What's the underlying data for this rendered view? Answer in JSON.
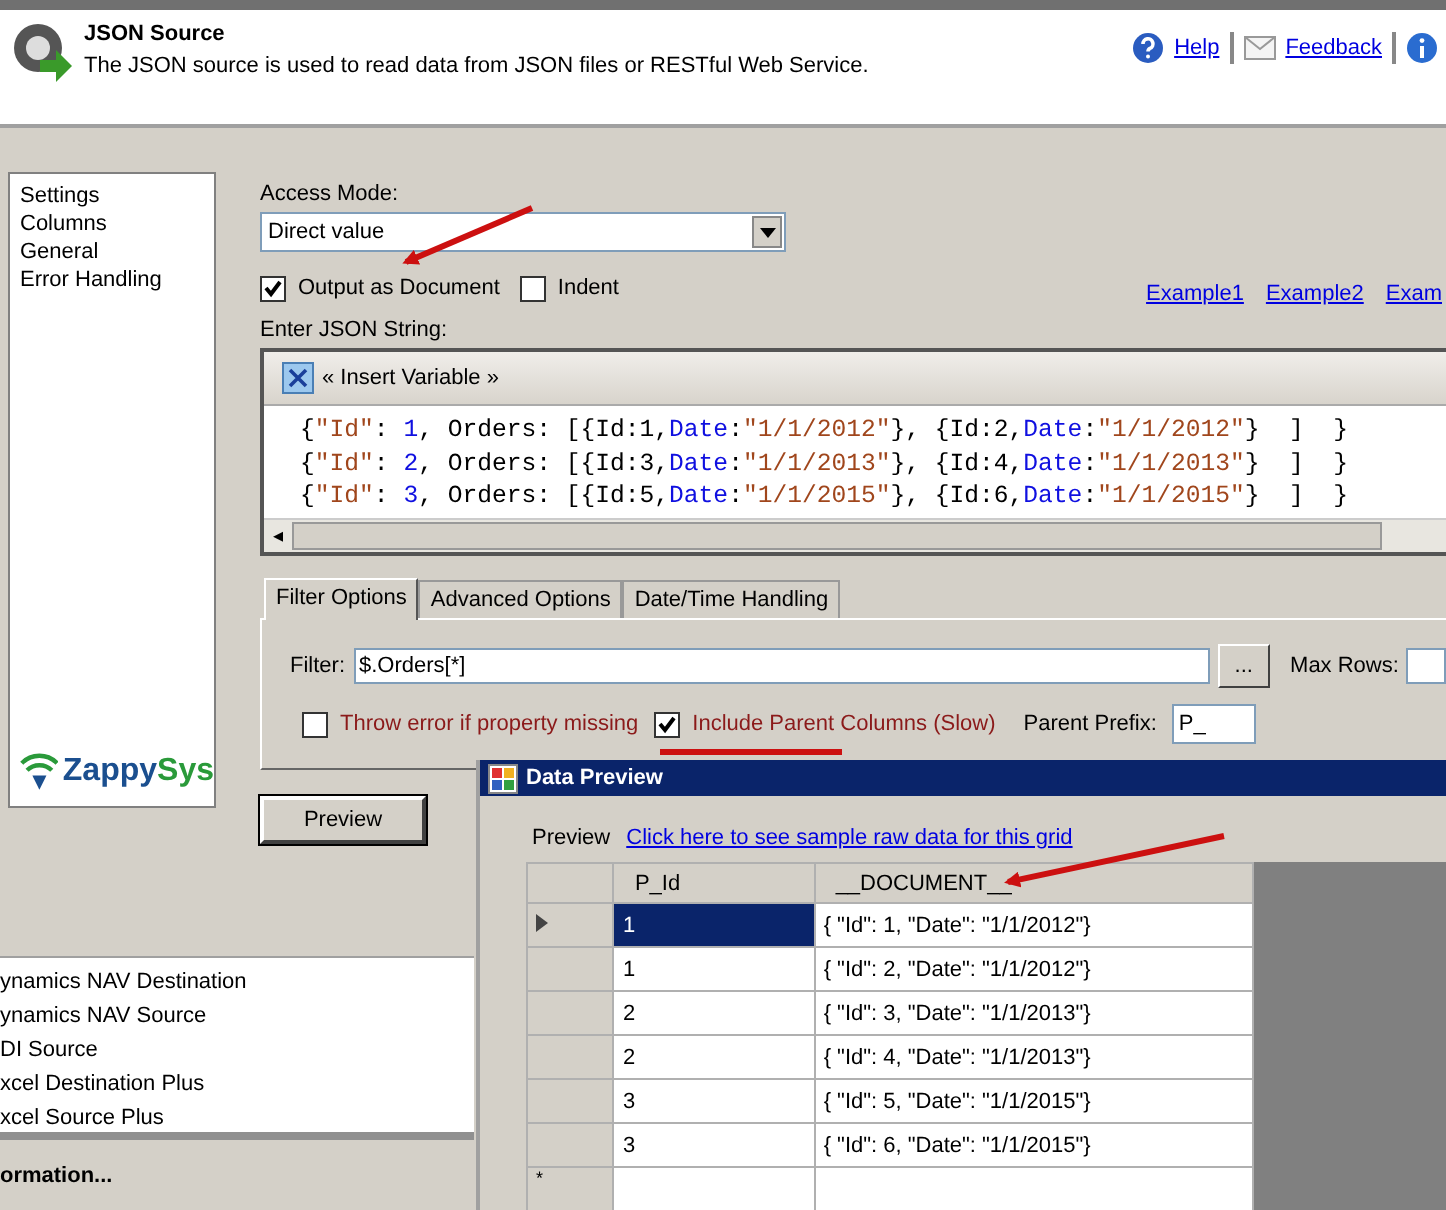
{
  "header": {
    "title": "JSON Source",
    "description": "The JSON source is used to read data from JSON files or RESTful Web Service.",
    "links": [
      {
        "kind": "help",
        "label": "Help"
      },
      {
        "kind": "feedback",
        "label": "Feedback"
      }
    ]
  },
  "nav": {
    "items": [
      "Settings",
      "Columns",
      "General",
      "Error Handling"
    ]
  },
  "logo": {
    "parts": [
      "Zappy",
      "Sys"
    ]
  },
  "access_mode": {
    "label": "Access Mode:",
    "value": "Direct value"
  },
  "options": [
    {
      "label": "Output as Document",
      "checked": true
    },
    {
      "label": "Indent",
      "checked": false
    }
  ],
  "examples": [
    "Example1",
    "Example2",
    "Exam"
  ],
  "editor": {
    "label": "Enter JSON String:",
    "insert_variable": "« Insert Variable »",
    "scroll_left": "◂",
    "lines": [
      [
        {
          "kind": "plain",
          "text": "{"
        },
        {
          "kind": "string",
          "text": "\"Id\""
        },
        {
          "kind": "plain",
          "text": ": "
        },
        {
          "kind": "keyword",
          "text": "1"
        },
        {
          "kind": "plain",
          "text": ", Orders: [{Id:1,"
        },
        {
          "kind": "keyword",
          "text": "Date"
        },
        {
          "kind": "plain",
          "text": ":"
        },
        {
          "kind": "string",
          "text": "\"1/1/2012\""
        },
        {
          "kind": "plain",
          "text": "}, {Id:2,"
        },
        {
          "kind": "keyword",
          "text": "Date"
        },
        {
          "kind": "plain",
          "text": ":"
        },
        {
          "kind": "string",
          "text": "\"1/1/2012\""
        },
        {
          "kind": "plain",
          "text": "}  ]  }"
        }
      ],
      [
        {
          "kind": "plain",
          "text": "{"
        },
        {
          "kind": "string",
          "text": "\"Id\""
        },
        {
          "kind": "plain",
          "text": ": "
        },
        {
          "kind": "keyword",
          "text": "2"
        },
        {
          "kind": "plain",
          "text": ", Orders: [{Id:3,"
        },
        {
          "kind": "keyword",
          "text": "Date"
        },
        {
          "kind": "plain",
          "text": ":"
        },
        {
          "kind": "string",
          "text": "\"1/1/2013\""
        },
        {
          "kind": "plain",
          "text": "}, {Id:4,"
        },
        {
          "kind": "keyword",
          "text": "Date"
        },
        {
          "kind": "plain",
          "text": ":"
        },
        {
          "kind": "string",
          "text": "\"1/1/2013\""
        },
        {
          "kind": "plain",
          "text": "}  ]  }"
        }
      ],
      [
        {
          "kind": "plain",
          "text": "{"
        },
        {
          "kind": "string",
          "text": "\"Id\""
        },
        {
          "kind": "plain",
          "text": ": "
        },
        {
          "kind": "keyword",
          "text": "3"
        },
        {
          "kind": "plain",
          "text": ", Orders: [{Id:5,"
        },
        {
          "kind": "keyword",
          "text": "Date"
        },
        {
          "kind": "plain",
          "text": ":"
        },
        {
          "kind": "string",
          "text": "\"1/1/2015\""
        },
        {
          "kind": "plain",
          "text": "}, {Id:6,"
        },
        {
          "kind": "keyword",
          "text": "Date"
        },
        {
          "kind": "plain",
          "text": ":"
        },
        {
          "kind": "string",
          "text": "\"1/1/2015\""
        },
        {
          "kind": "plain",
          "text": "}  ]  }"
        }
      ]
    ]
  },
  "tabs": [
    {
      "label": "Filter Options",
      "selected": true
    },
    {
      "label": "Advanced Options",
      "selected": false
    },
    {
      "label": "Date/Time Handling",
      "selected": false
    }
  ],
  "filter": {
    "label": "Filter:",
    "value": "$.Orders[*]",
    "browse": "...",
    "max_rows_label": "Max Rows:"
  },
  "flags": [
    {
      "label": "Throw error if property missing",
      "checked": false
    },
    {
      "label": "Include Parent Columns (Slow)",
      "checked": true
    }
  ],
  "parent_prefix": {
    "label": "Parent Prefix:",
    "value": "P_"
  },
  "preview_button": "Preview",
  "toolbox": {
    "items": [
      "ynamics NAV Destination",
      "ynamics NAV Source",
      "DI Source",
      "xcel Destination Plus",
      "xcel Source Plus"
    ],
    "footer": "ormation..."
  },
  "data_preview": {
    "title": "Data Preview",
    "label": "Preview",
    "link": "Click here to see sample raw data for this grid",
    "columns": [
      "P_Id",
      "__DOCUMENT__"
    ],
    "new_row_marker": "*",
    "rows": [
      {
        "selected": true,
        "cells": [
          "1",
          "{  \"Id\": 1,  \"Date\": \"1/1/2012\"}"
        ]
      },
      {
        "selected": false,
        "cells": [
          "1",
          "{  \"Id\": 2,  \"Date\": \"1/1/2012\"}"
        ]
      },
      {
        "selected": false,
        "cells": [
          "2",
          "{  \"Id\": 3,  \"Date\": \"1/1/2013\"}"
        ]
      },
      {
        "selected": false,
        "cells": [
          "2",
          "{  \"Id\": 4,  \"Date\": \"1/1/2013\"}"
        ]
      },
      {
        "selected": false,
        "cells": [
          "3",
          "{  \"Id\": 5,  \"Date\": \"1/1/2015\"}"
        ]
      },
      {
        "selected": false,
        "cells": [
          "3",
          "{  \"Id\": 6,  \"Date\": \"1/1/2015\"}"
        ]
      }
    ]
  }
}
